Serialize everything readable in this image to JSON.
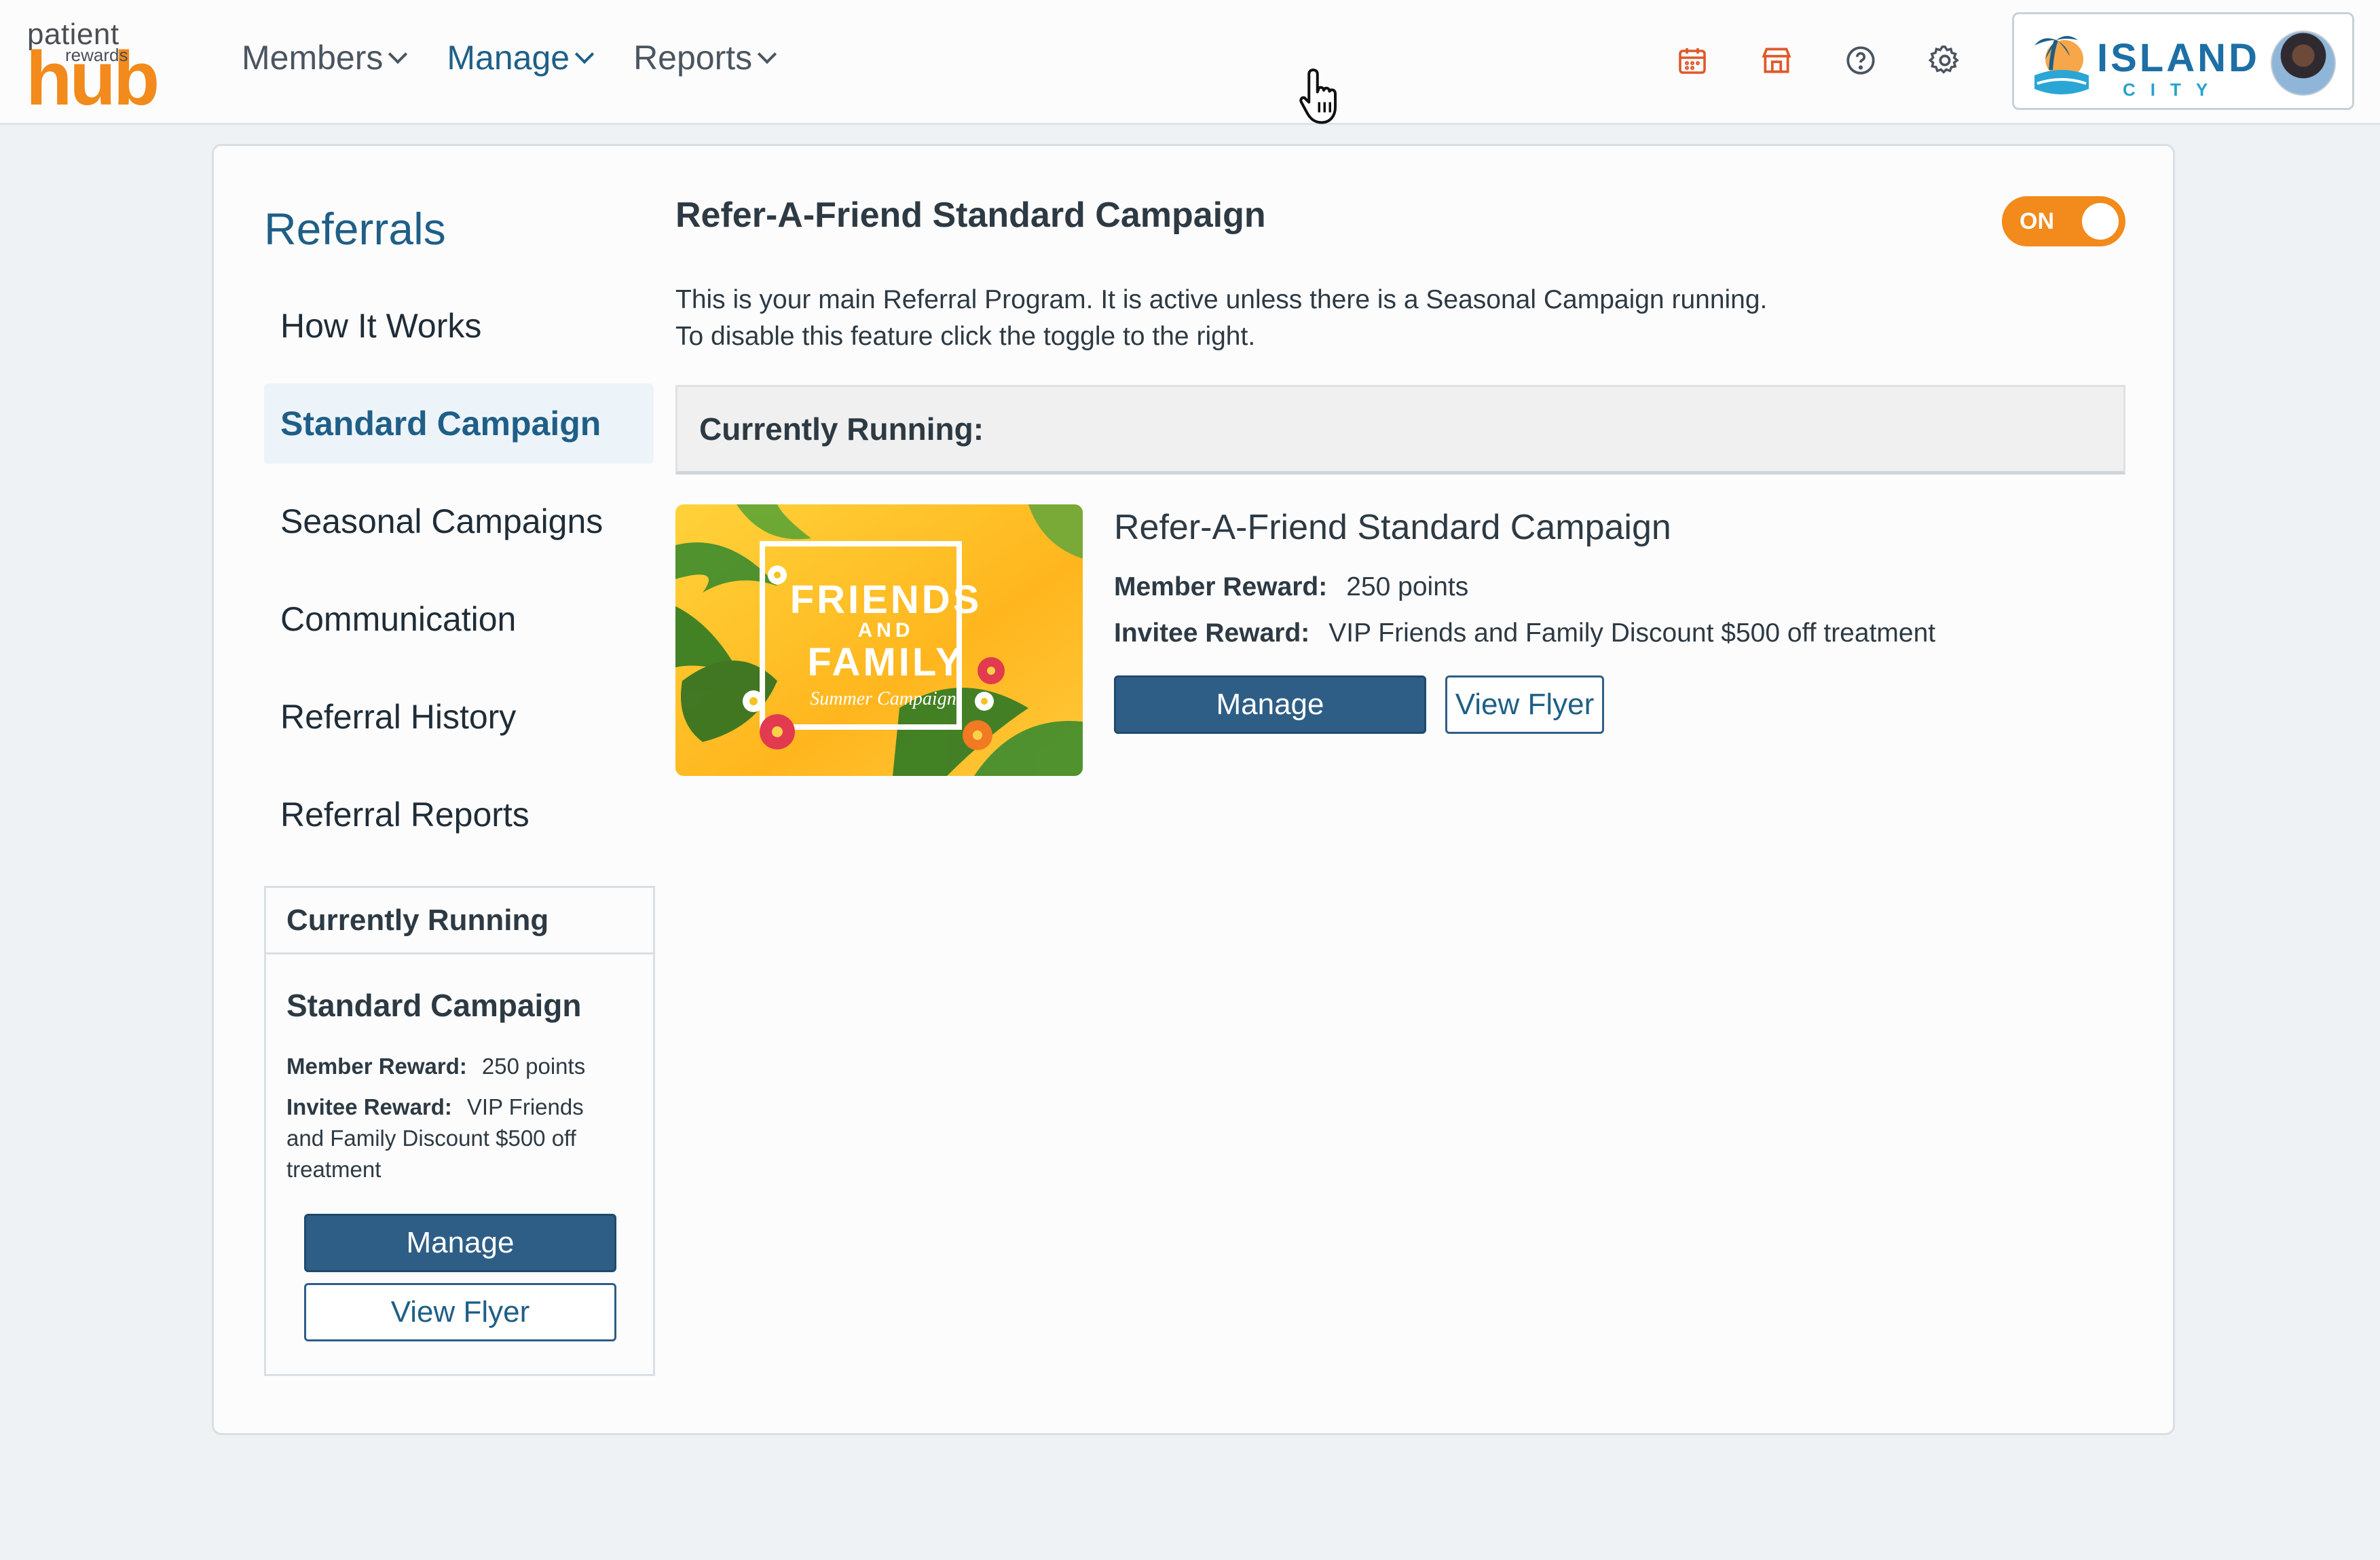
{
  "header": {
    "logo": {
      "top": "patient",
      "middle": "rewards",
      "bottom": "hub"
    },
    "nav": [
      {
        "label": "Members",
        "active": false
      },
      {
        "label": "Manage",
        "active": true
      },
      {
        "label": "Reports",
        "active": false
      }
    ],
    "icons": [
      "calendar-icon",
      "storefront-icon",
      "help-icon",
      "settings-icon"
    ],
    "brand": {
      "name": "ISLAND",
      "sub": "CITY"
    },
    "colors": {
      "accent": "#f28a1c",
      "primary": "#1f5f87",
      "button": "#2e5e86"
    }
  },
  "sidebar": {
    "title": "Referrals",
    "items": [
      {
        "label": "How It Works",
        "active": false
      },
      {
        "label": "Standard Campaign",
        "active": true
      },
      {
        "label": "Seasonal Campaigns",
        "active": false
      },
      {
        "label": "Communication",
        "active": false
      },
      {
        "label": "Referral History",
        "active": false
      },
      {
        "label": "Referral Reports",
        "active": false
      }
    ],
    "running": {
      "heading": "Currently Running",
      "title": "Standard Campaign",
      "member_label": "Member Reward:",
      "member_value": "250 points",
      "invitee_label": "Invitee Reward:",
      "invitee_value": "VIP Friends and Family Discount $500 off treatment",
      "manage_label": "Manage",
      "flyer_label": "View Flyer"
    }
  },
  "main": {
    "title": "Refer-A-Friend Standard Campaign",
    "toggle_label": "ON",
    "desc_line1": "This is your main Referral Program. It is active unless there is a Seasonal Campaign running.",
    "desc_line2": "To disable this feature click the toggle to the right.",
    "running_heading": "Currently Running:",
    "flyer": {
      "line1": "FRIENDS",
      "line2": "AND",
      "line3": "FAMILY",
      "line4": "Summer Campaign"
    },
    "campaign": {
      "name": "Refer-A-Friend Standard Campaign",
      "member_label": "Member Reward:",
      "member_value": "250 points",
      "invitee_label": "Invitee Reward:",
      "invitee_value": "VIP Friends and Family Discount $500 off treatment",
      "manage_label": "Manage",
      "flyer_label": "View Flyer"
    }
  }
}
